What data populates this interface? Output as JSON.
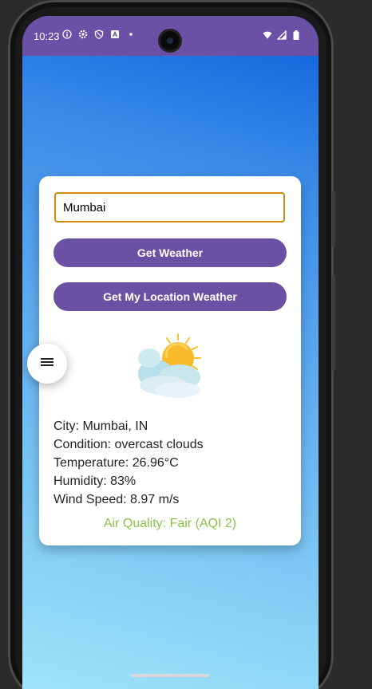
{
  "status_bar": {
    "time": "10:23",
    "icons": [
      "info-icon",
      "settings-icon",
      "shield-icon",
      "a-icon",
      "dot-icon"
    ],
    "right_icons": [
      "wifi-icon",
      "signal-icon",
      "battery-icon"
    ],
    "color": "#6b51a6"
  },
  "search": {
    "value": "Mumbai",
    "placeholder": ""
  },
  "buttons": {
    "get_weather": "Get Weather",
    "get_location_weather": "Get My Location Weather"
  },
  "weather": {
    "icon": "partly-cloudy-icon",
    "city": "City: Mumbai, IN",
    "condition": "Condition: overcast clouds",
    "temperature": "Temperature: 26.96°C",
    "humidity": "Humidity: 83%",
    "wind_speed": "Wind Speed: 8.97 m/s",
    "air_quality": "Air Quality: Fair (AQI 2)"
  },
  "colors": {
    "accent": "#6a51a4",
    "input_border": "#d28a0a",
    "aqi": "#8bc34a"
  },
  "fab": {
    "icon": "menu-icon"
  }
}
